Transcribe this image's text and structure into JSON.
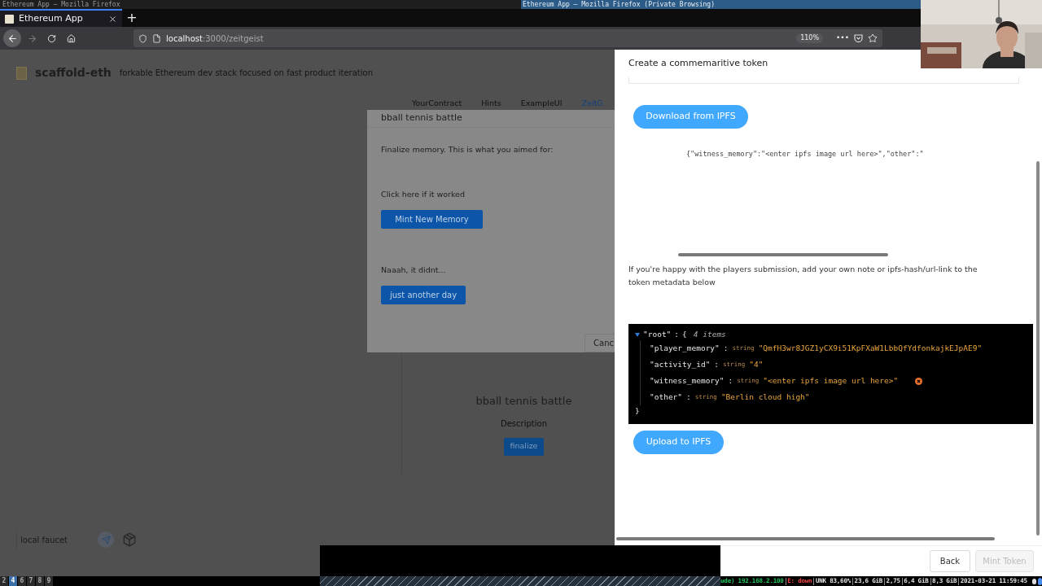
{
  "title_bar": {
    "left": "Ethereum App — Mozilla Firefox",
    "right": "Ethereum App — Mozilla Firefox (Private Browsing)"
  },
  "browser": {
    "tabs": [
      {
        "label": "Ethereum App",
        "selected": true
      }
    ],
    "new_tab": "+",
    "address_host": "localhost",
    "address_rest": ":3000/zeitgeist",
    "zoom": "110%",
    "more": "•••"
  },
  "app": {
    "logo": "scaffold-eth",
    "tagline": "forkable Ethereum dev stack focused on fast product iteration",
    "nav": [
      {
        "label": "YourContract",
        "selected": false
      },
      {
        "label": "Hints",
        "selected": false
      },
      {
        "label": "ExampleUI",
        "selected": false
      },
      {
        "label": "ZeitG",
        "selected": true
      }
    ],
    "card": {
      "title": "bball tennis battle",
      "description": "Description",
      "button": "finalize"
    },
    "faucet": {
      "placeholder": "local faucet"
    }
  },
  "modal": {
    "title": "bball tennis battle",
    "intro": "Finalize memory. This is what you aimed for:",
    "success_label": "Click here if it worked",
    "success_button": "Mint New Memory",
    "fail_label": "Naaah, it didnt...",
    "fail_button": "just another day",
    "cancel": "Canc"
  },
  "drawer": {
    "title": "Create a commemaritive token",
    "download_button": "Download from IPFS",
    "code_line": "{\"witness_memory\":\"<enter ipfs image url here>\",\"other\":\"",
    "note": "If you're happy with the players submission, add your own note or ipfs-hash/url-link to the token metadata below",
    "json_viewer": {
      "root": "\"root\"",
      "separator": ":",
      "open": "{",
      "count": "4 items",
      "close": "}",
      "expanded": true,
      "entries": [
        {
          "key": "\"player_memory\"",
          "type": "string",
          "value": "\"QmfH3wr8JGZ1yCX9i51KpFXaW1LbbQfYdfonkajkEJpAE9\"",
          "editing": false
        },
        {
          "key": "\"activity_id\"",
          "type": "string",
          "value": "\"4\"",
          "editing": false
        },
        {
          "key": "\"witness_memory\"",
          "type": "string",
          "value": "\"<enter ipfs image url here>\"",
          "editing": true
        },
        {
          "key": "\"other\"",
          "type": "string",
          "value": "\"Berlin cloud high\"",
          "editing": false
        }
      ]
    },
    "upload_button": "Upload to IPFS",
    "back_button": "Back",
    "mint_button": {
      "label": "Mint Token",
      "disabled": true
    }
  },
  "status_bar": {
    "workspaces": [
      {
        "label": "2",
        "selected": false
      },
      {
        "label": "4",
        "selected": true
      },
      {
        "label": "6",
        "selected": false
      },
      {
        "label": "7",
        "selected": false
      },
      {
        "label": "8",
        "selected": false
      },
      {
        "label": "9",
        "selected": false
      }
    ],
    "items": [
      {
        "text": "ude) 192.168.2.100",
        "kind": "network"
      },
      {
        "text": "E: down",
        "kind": "alert"
      },
      {
        "text": "UNK 83,60%",
        "kind": "normal"
      },
      {
        "text": "23,6 GiB",
        "kind": "normal"
      },
      {
        "text": "2,75",
        "kind": "normal"
      },
      {
        "text": "6,4 GiB",
        "kind": "normal"
      },
      {
        "text": "8,3 GiB",
        "kind": "normal"
      },
      {
        "text": "2021-03-21 11:59:45",
        "kind": "normal"
      }
    ]
  }
}
